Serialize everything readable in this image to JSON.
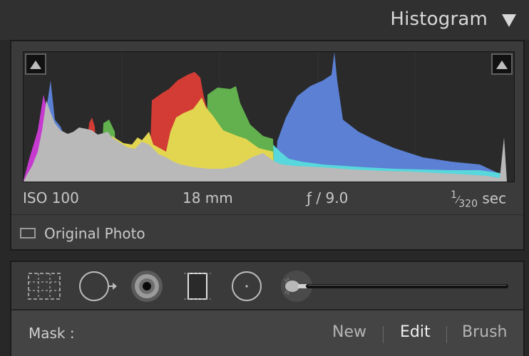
{
  "panel": {
    "title": "Histogram"
  },
  "histogram": {
    "shadow_clip_label": "shadow clipping",
    "highlight_clip_label": "highlight clipping"
  },
  "exif": {
    "iso": "ISO 100",
    "focal_length": "18 mm",
    "aperture": "ƒ / 9.0",
    "shutter_num": "1",
    "shutter_den": "320",
    "shutter_unit": "sec"
  },
  "original_photo": {
    "label": "Original Photo",
    "checked": false
  },
  "tools": {
    "icons": [
      "crop-overlay-icon",
      "spot-removal-icon",
      "red-eye-icon",
      "graduated-filter-icon",
      "radial-filter-icon",
      "adjustment-brush-icon"
    ],
    "brush_slider": 1.0
  },
  "mask": {
    "label": "Mask :",
    "new_label": "New",
    "edit_label": "Edit",
    "brush_label": "Brush",
    "selected": "Edit"
  },
  "colors": {
    "red": "#d23c34",
    "green": "#62b14e",
    "yellow": "#e2d651",
    "blue": "#5b80d4",
    "cyan": "#58d7dc",
    "magenta": "#c73ad0",
    "gray": "#b9b9b9"
  }
}
